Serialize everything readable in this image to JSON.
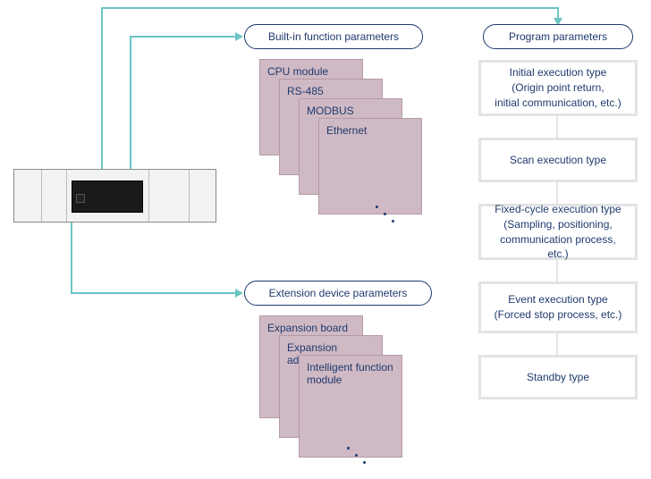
{
  "headers": {
    "builtin": "Built-in function parameters",
    "program": "Program parameters",
    "extension": "Extension device parameters"
  },
  "cards_builtin": {
    "cpu": "CPU module",
    "rs485": "RS-485",
    "modbus": "MODBUS",
    "ethernet": "Ethernet"
  },
  "cards_extension": {
    "board": "Expansion board",
    "adapter": "Expansion adapter",
    "intelligent": "Intelligent function module"
  },
  "types": {
    "initial": "Initial execution type\n(Origin point return,\ninitial communication, etc.)",
    "scan": "Scan execution type",
    "fixed": "Fixed-cycle execution type\n(Sampling, positioning,\ncommunication process, etc.)",
    "event": "Event execution type\n(Forced stop process, etc.)",
    "standby": "Standby type"
  }
}
